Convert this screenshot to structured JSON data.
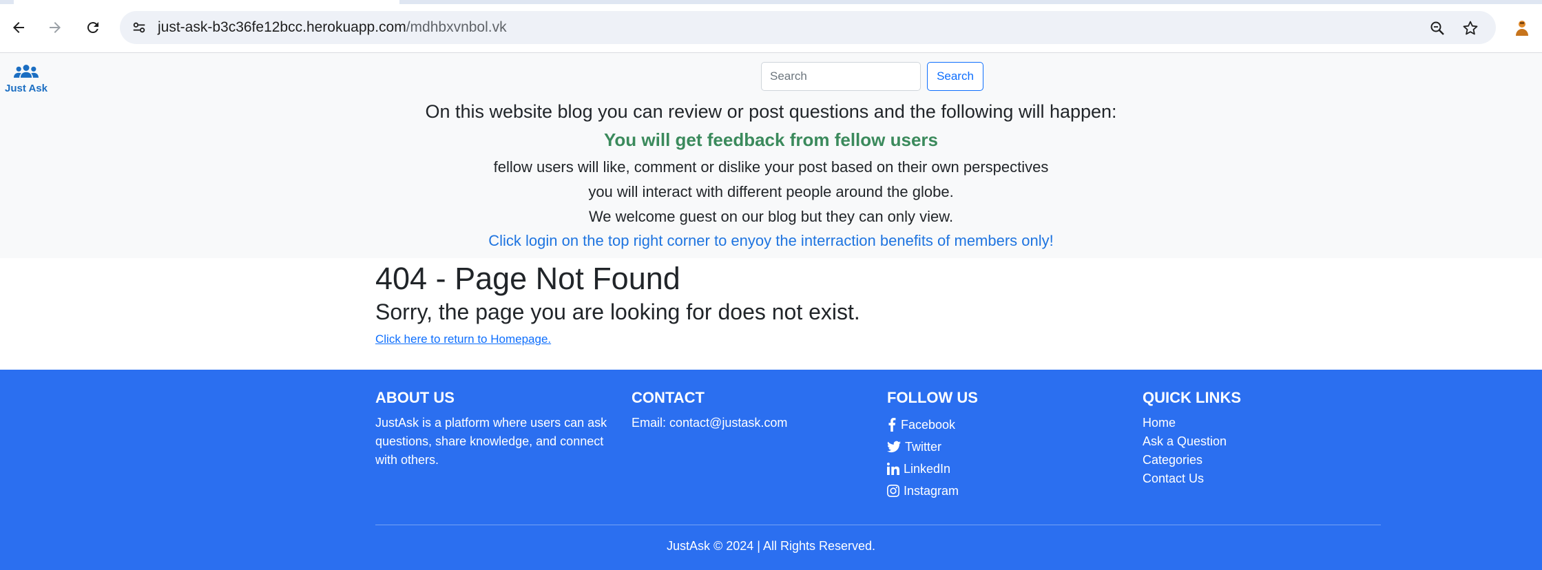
{
  "browser": {
    "url_host": "just-ask-b3c36fe12bcc.herokuapp.com",
    "url_path": "/mdhbxvnbol.vk"
  },
  "navbar": {
    "brand": "Just Ask",
    "search_placeholder": "Search",
    "search_button": "Search"
  },
  "intro": {
    "heading": "On this website blog you can review or post questions and the following will happen:",
    "subheading": "You will get feedback from fellow users",
    "line1": "fellow users will like, comment or dislike your post based on their own perspectives",
    "line2": "you will interact with different people around the globe.",
    "line3": "We welcome guest on our blog but they can only view.",
    "line4": "Click login on the top right corner to enyoy the interraction benefits of members only!"
  },
  "error": {
    "title": "404 - Page Not Found",
    "message": "Sorry, the page you are looking for does not exist.",
    "link": "Click here to return to Homepage."
  },
  "footer": {
    "about": {
      "title": "ABOUT US",
      "text": "JustAsk is a platform where users can ask questions, share knowledge, and connect with others."
    },
    "contact": {
      "title": "CONTACT",
      "email": "Email: contact@justask.com"
    },
    "follow": {
      "title": "FOLLOW US",
      "items": [
        {
          "label": "Facebook",
          "icon": "facebook-icon"
        },
        {
          "label": "Twitter",
          "icon": "twitter-icon"
        },
        {
          "label": "LinkedIn",
          "icon": "linkedin-icon"
        },
        {
          "label": "Instagram",
          "icon": "instagram-icon"
        }
      ]
    },
    "quick": {
      "title": "QUICK LINKS",
      "items": [
        "Home",
        "Ask a Question",
        "Categories",
        "Contact Us"
      ]
    },
    "copyright": "JustAsk © 2024 | All Rights Reserved."
  },
  "colors": {
    "footer_bg": "#2b6ff0",
    "feedback_green": "#3b8a5c",
    "login_blue": "#1e74e0",
    "link_blue": "#0d6efd"
  }
}
